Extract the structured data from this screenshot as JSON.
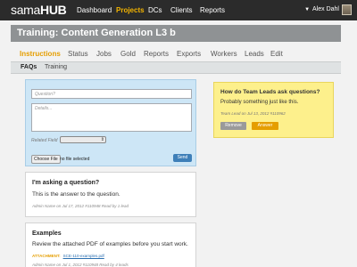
{
  "app": {
    "logo_light": "sama",
    "logo_bold": "HUB",
    "nav": [
      "Dashboard",
      "Projects",
      "DCs",
      "Clients",
      "Reports"
    ],
    "user_name": "Alex Dahl"
  },
  "page": {
    "title": "Training: Content Generation L3 b"
  },
  "tabs": [
    "Instructions",
    "Status",
    "Jobs",
    "Gold",
    "Reports",
    "Exports",
    "Workers",
    "Leads",
    "Edit"
  ],
  "subtabs": [
    "FAQs",
    "Training"
  ],
  "form": {
    "question_placeholder": "Question?",
    "details_placeholder": "Details...",
    "related_field_label": "Related Field",
    "choose_file_label": "Choose File",
    "no_file_text": "no file selected",
    "send_label": "Send"
  },
  "faq": [
    {
      "question": "I'm asking a question?",
      "answer": "This is the answer to the question.",
      "meta": "Admin Name on Jul 17, 2012   #110948   Read by 1 lead"
    },
    {
      "question": "Examples",
      "answer": "Review the attached PDF of examples before you start work.",
      "attachment_label": "ATTACHMENT:",
      "attachment_file": "SCE-110-examples.pdf",
      "meta": "Admin Name on Jul 1, 2012   #110948   Read by 4 leads"
    }
  ],
  "lead_question": {
    "title": "How do Team Leads ask questions?",
    "text": "Probably something just like this.",
    "meta": "Team Lead on Jul 13, 2012   #110962",
    "remove_label": "Remove",
    "answer_label": "Answer"
  },
  "colors": {
    "topbar": "#2b2b2b",
    "accent": "#e59e00",
    "nav_active": "#f3b400",
    "title_bar": "#8f9294",
    "form_bg": "#cde6f6",
    "note_bg": "#fdf08c",
    "send_button": "#3e7fb8"
  },
  "icons": {
    "select_arrow": "updown-arrows-icon",
    "avatar": "user-avatar"
  }
}
